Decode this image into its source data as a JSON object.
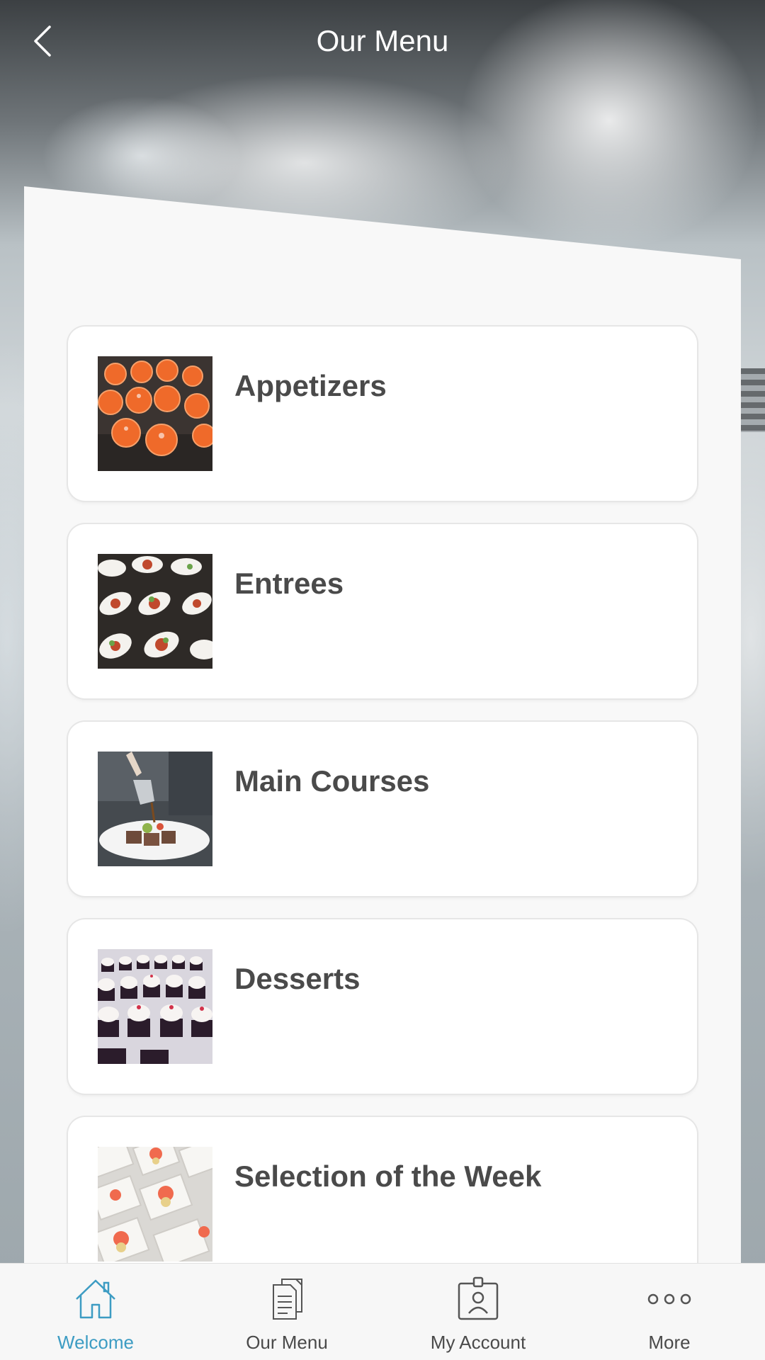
{
  "header": {
    "title": "Our Menu",
    "back_icon": "chevron-left-icon"
  },
  "menu": {
    "items": [
      {
        "label": "Appetizers",
        "image": "appetizers-photo"
      },
      {
        "label": "Entrees",
        "image": "entrees-photo"
      },
      {
        "label": "Main Courses",
        "image": "main-courses-photo"
      },
      {
        "label": "Desserts",
        "image": "desserts-photo"
      },
      {
        "label": "Selection of the Week",
        "image": "selection-photo"
      }
    ]
  },
  "tabbar": {
    "tabs": [
      {
        "label": "Welcome",
        "icon": "home-icon",
        "active": true
      },
      {
        "label": "Our Menu",
        "icon": "document-icon",
        "active": false
      },
      {
        "label": "My Account",
        "icon": "id-badge-icon",
        "active": false
      },
      {
        "label": "More",
        "icon": "more-dots-icon",
        "active": false
      }
    ]
  },
  "colors": {
    "accent": "#3d9cc3",
    "text": "#4a4a4a",
    "panel": "#f8f8f8"
  }
}
